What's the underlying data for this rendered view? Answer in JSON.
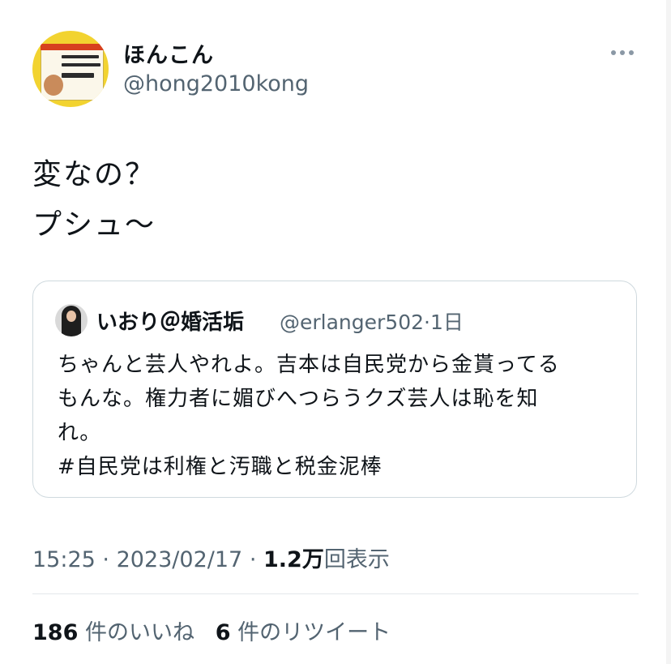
{
  "author": {
    "display_name": "ほんこん",
    "handle": "@hong2010kong",
    "avatar_icon": "profile-photo-book-cover"
  },
  "tweet": {
    "lines": [
      "変なの？",
      "プシュ〜"
    ]
  },
  "quoted_tweet": {
    "display_name": "いおり＠婚活垢",
    "handle": "@erlanger502",
    "separator": "·",
    "age": "1日",
    "lines": [
      "ちゃんと芸人やれよ。吉本は自民党から金貰ってる",
      "もんな。権力者に媚びへつらうクズ芸人は恥を知",
      "れ。",
      "#自民党は利権と汚職と税金泥棒"
    ]
  },
  "meta": {
    "time": "15:25",
    "sep": "·",
    "date": "2023/02/17",
    "views_number": "1.2万",
    "views_label": "回表示"
  },
  "stats": {
    "likes_count": "186",
    "likes_label": "件のいいね",
    "retweets_count": "6",
    "retweets_label": "件のリツイート"
  },
  "colors": {
    "text": "#0f1419",
    "secondary": "#536471",
    "border": "#cfd9de"
  }
}
